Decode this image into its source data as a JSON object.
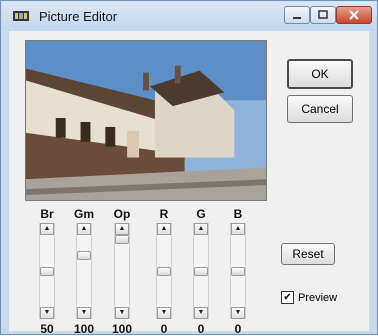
{
  "window": {
    "title": "Picture Editor"
  },
  "buttons": {
    "ok": "OK",
    "cancel": "Cancel",
    "reset": "Reset"
  },
  "preview_checkbox": {
    "label": "Preview",
    "checked": true
  },
  "sliders": [
    {
      "label": "Br",
      "value": "50",
      "level": 0.5
    },
    {
      "label": "Gm",
      "value": "100",
      "level": 0.25
    },
    {
      "label": "Op",
      "value": "100",
      "level": 0.0
    },
    {
      "label": "R",
      "value": "0",
      "level": 0.5
    },
    {
      "label": "G",
      "value": "0",
      "level": 0.5
    },
    {
      "label": "B",
      "value": "0",
      "level": 0.5
    }
  ]
}
